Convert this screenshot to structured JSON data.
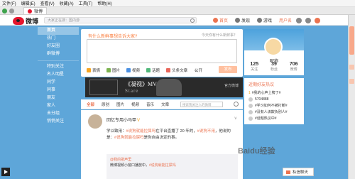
{
  "browser": {
    "menu": [
      "文件(F)",
      "编辑(E)",
      "查看(V)",
      "收藏(A)",
      "工具(T)",
      "帮助(H)"
    ],
    "tab_title": "微博"
  },
  "topbar": {
    "logo_text": "微博",
    "search_placeholder": "大家正在搜：国内游",
    "nav": [
      {
        "label": "首页",
        "active": true
      },
      {
        "label": "发现",
        "active": false
      },
      {
        "label": "游戏",
        "active": false
      }
    ],
    "username": "用户名"
  },
  "sidebar": {
    "items": [
      "首页",
      "热门",
      "好友圈",
      "群微博",
      "特别关注",
      "名人明星",
      "同学",
      "同事",
      "朋友",
      "家人",
      "未分组",
      "悄悄关注"
    ],
    "active_index": 0
  },
  "publish": {
    "prompt": "有什么新鲜事想告诉大家?",
    "count_hint": "今天你有什么新鲜事？",
    "tools": [
      "表情",
      "图片",
      "视频",
      "话题",
      "头条文章",
      "..."
    ],
    "visibility": "公开",
    "send_label": "发布"
  },
  "banner": {
    "title": "《凝视》MV",
    "subtitle": "Stare",
    "right_text": "官方微博"
  },
  "filter": {
    "tabs": [
      "全部",
      "原创",
      "图片",
      "视频",
      "音乐",
      "文章"
    ],
    "search_placeholder": "搜索我关注人的微博"
  },
  "feed": {
    "username": "回忆专用小马甲",
    "badge": "V",
    "text_parts": [
      "学以致用：",
      "#说狗就能拉屎吗",
      "在平台直播了 20 年的，",
      "#说狗不用",
      "，他说的是：",
      "#说狗就能拉屎吗",
      "是你自由决定的事。"
    ],
    "quote_user": "@我的歌声里",
    "quote_text": "微博视频小窗口播放中，",
    "quote_link": "#说狗就能拉屎吗"
  },
  "profile": {
    "name": "昵称",
    "stats": [
      {
        "n": "125",
        "l": "关注"
      },
      {
        "n": "39",
        "l": "粉丝"
      },
      {
        "n": "706",
        "l": "微博"
      }
    ]
  },
  "right_card": {
    "title": "近期好友热议",
    "rows": [
      {
        "tag": "1",
        "text": "#我的心声上榜了#",
        "num": ""
      },
      {
        "tag": "",
        "text": "5704888",
        "num": ""
      },
      {
        "tag": "",
        "text": "#学习如何不被打断#",
        "num": ""
      },
      {
        "tag": "",
        "text": "#没有人该欺负别人#",
        "num": ""
      },
      {
        "tag": "",
        "text": "#话题热议中#",
        "num": ""
      }
    ]
  },
  "pm_label": "私信聊天",
  "watermark": "Baidu经验"
}
